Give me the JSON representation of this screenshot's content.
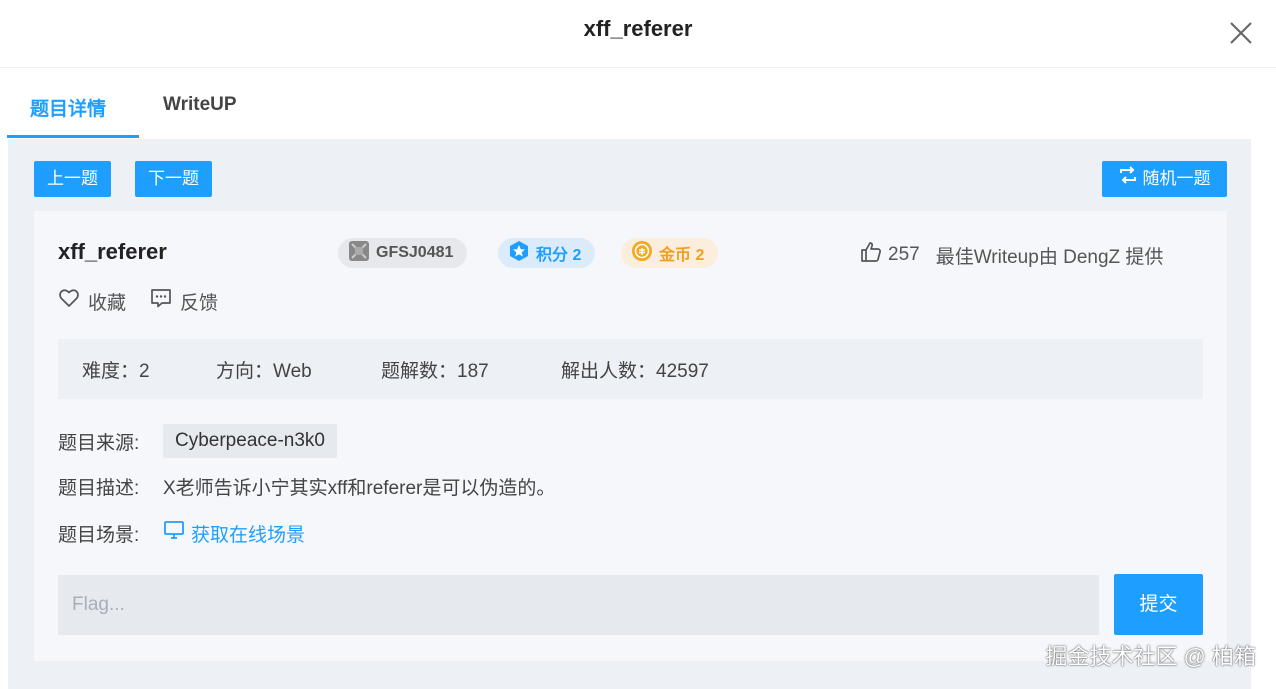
{
  "dialog": {
    "title": "xff_referer"
  },
  "tabs": [
    {
      "label": "题目详情",
      "active": true
    },
    {
      "label": "WriteUP",
      "active": false
    }
  ],
  "toolbar": {
    "prev_label": "上一题",
    "next_label": "下一题",
    "random_label": "随机一题"
  },
  "challenge": {
    "name": "xff_referer",
    "id": "GFSJ0481",
    "score_label": "积分 2",
    "coin_label": "金币 2",
    "likes": "257",
    "writeup_credit": "最佳Writeup由 DengZ 提供",
    "favorite_label": "收藏",
    "feedback_label": "反馈",
    "stats": {
      "difficulty": "难度：2",
      "direction": "方向：Web",
      "writeup_count": "题解数：187",
      "solvers": "解出人数：42597"
    },
    "source_label": "题目来源:",
    "source_value": "Cyberpeace-n3k0",
    "desc_label": "题目描述:",
    "desc_value": "X老师告诉小宁其实xff和referer是可以伪造的。",
    "scene_label": "题目场景:",
    "scene_link": "获取在线场景"
  },
  "flag": {
    "placeholder": "Flag...",
    "submit_label": "提交"
  },
  "watermark": "掘金技术社区 @ 柏箱",
  "colors": {
    "accent": "#1e9fff",
    "coin": "#f0a020",
    "panel_bg": "#edf1f6"
  }
}
